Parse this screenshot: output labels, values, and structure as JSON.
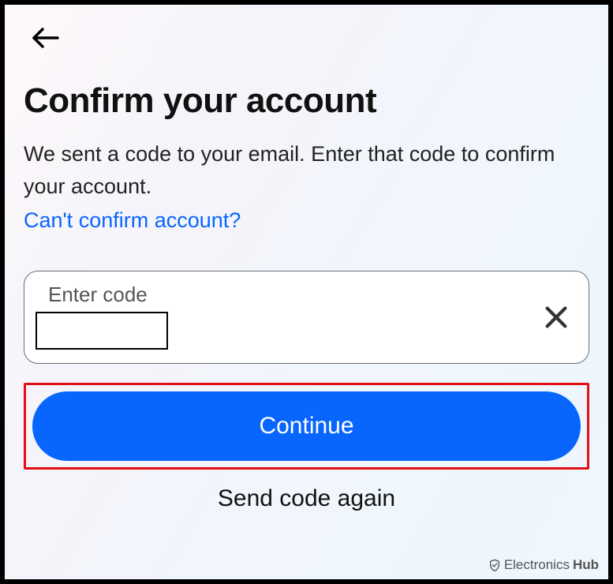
{
  "header": {
    "title": "Confirm your account",
    "subtext": "We sent a code to your email. Enter that code to confirm your account.",
    "help_link": "Can't confirm account?"
  },
  "form": {
    "input_label": "Enter code",
    "input_value": "",
    "continue_label": "Continue",
    "resend_label": "Send code again"
  },
  "icons": {
    "back": "back-arrow-icon",
    "clear": "close-icon",
    "shield": "shield-icon"
  },
  "watermark": {
    "brand_main": "Electronics",
    "brand_sub": "Hub"
  }
}
